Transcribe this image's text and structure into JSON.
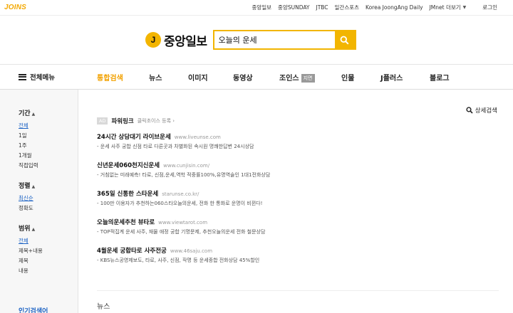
{
  "topbar": {
    "logo": "JOINS",
    "links": [
      "중앙일보",
      "중앙SUNDAY",
      "JTBC",
      "일간스포츠",
      "Korea JoongAng Daily",
      "JMnet 더보기"
    ],
    "login": "로그인"
  },
  "brand": {
    "mark": "J",
    "name": "중앙일보"
  },
  "search": {
    "value": "오늘의 운세"
  },
  "nav": {
    "all_menu": "전체메뉴",
    "tabs": [
      "통합검색",
      "뉴스",
      "이미지",
      "동영상",
      "조인스",
      "인물",
      "J플러스",
      "블로그"
    ],
    "joins_badge": "지면",
    "active": "통합검색"
  },
  "filters": {
    "period": {
      "title": "기간",
      "options": [
        "전체",
        "1일",
        "1주",
        "1개월",
        "직접입력"
      ]
    },
    "sort": {
      "title": "정렬",
      "options": [
        "최신순",
        "정확도"
      ]
    },
    "scope": {
      "title": "범위",
      "options": [
        "전체",
        "제목+내용",
        "제목",
        "내용"
      ]
    },
    "popular": "인기검색어"
  },
  "detail_search": "상세검색",
  "powerlink": {
    "badge": "AD",
    "title": "파워링크",
    "sub": "클릭초이스 등록 ›",
    "ads": [
      {
        "title": "24시간 상담대기 라이브운세",
        "url": "www.liveunse.com",
        "desc": "- 운세 사주 궁합 신점 타로 다른곳과 차별화된 속시원 명쾌한답변 24시상담"
      },
      {
        "title": "신년운세060천지신운세",
        "url": "www.cunjisin.com/",
        "desc": "- 거침없는 미래예측! 타로, 신점,운세,역학 적중률100%,유명역술인 1대1전화상담"
      },
      {
        "title": "365일 신통한 스타운세",
        "url": "starunse.co.kr/",
        "desc": "- 100만 이용자가 추천하는060스타오늘의운세, 전화 한 통화로 운명이 비뀐다!"
      },
      {
        "title": "오늘의운세추천 뷰타로",
        "url": "www.viewtarot.com",
        "desc": "- TOP적집계 운세 사주, 재물 애정 궁합 기명문제, 추천오늘의운세 전화 철문상담"
      },
      {
        "title": "4월운세 궁합타로 사주전궁",
        "url": "www.46saju.com",
        "desc": "- KBS뉴스공영제보도, 타로, 사주, 신점, 작명 등 운세종합 전화상담 45%할인"
      }
    ]
  },
  "news_heading": "뉴스",
  "colors": {
    "accent": "#f2b500",
    "active_tab": "#f2a100",
    "link": "#1d63c4"
  }
}
